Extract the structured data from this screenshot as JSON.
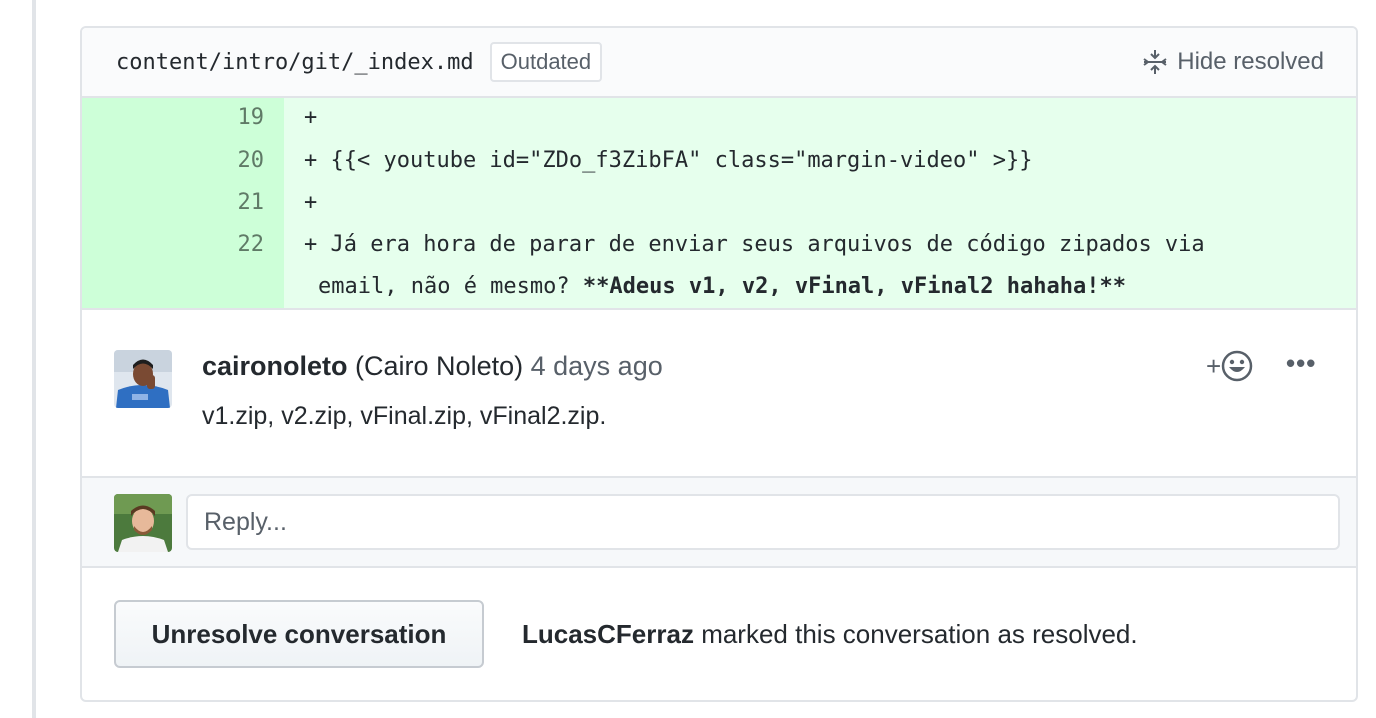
{
  "file_header": {
    "path": "content/intro/git/_index.md",
    "outdated_label": "Outdated",
    "hide_resolved_label": "Hide resolved"
  },
  "diff": {
    "lines": [
      {
        "num": "19",
        "code": "+"
      },
      {
        "num": "20",
        "code": "+ {{< youtube id=\"ZDo_f3ZibFA\" class=\"margin-video\" >}}"
      },
      {
        "num": "21",
        "code": "+"
      },
      {
        "num": "22",
        "code": "+ Já era hora de parar de enviar seus arquivos de código zipados via",
        "cont_plain": "email, não é mesmo? ",
        "cont_bold": "**Adeus v1, v2, vFinal, vFinal2 hahaha!**"
      }
    ]
  },
  "comment": {
    "author": "caironoleto",
    "full_name": "(Cairo Noleto)",
    "time_ago": "4 days ago",
    "body": "v1.zip, v2.zip, vFinal.zip, vFinal2.zip.",
    "reaction_icon": "smiley-icon",
    "more_label": "•••"
  },
  "reply": {
    "placeholder": "Reply..."
  },
  "resolution": {
    "button_label": "Unresolve conversation",
    "user": "LucasCFerraz",
    "message": " marked this conversation as resolved."
  },
  "colors": {
    "diff_add_bg": "#e6ffed",
    "diff_num_bg": "#cdffd8",
    "border": "#e1e4e8",
    "muted_text": "#586069"
  }
}
